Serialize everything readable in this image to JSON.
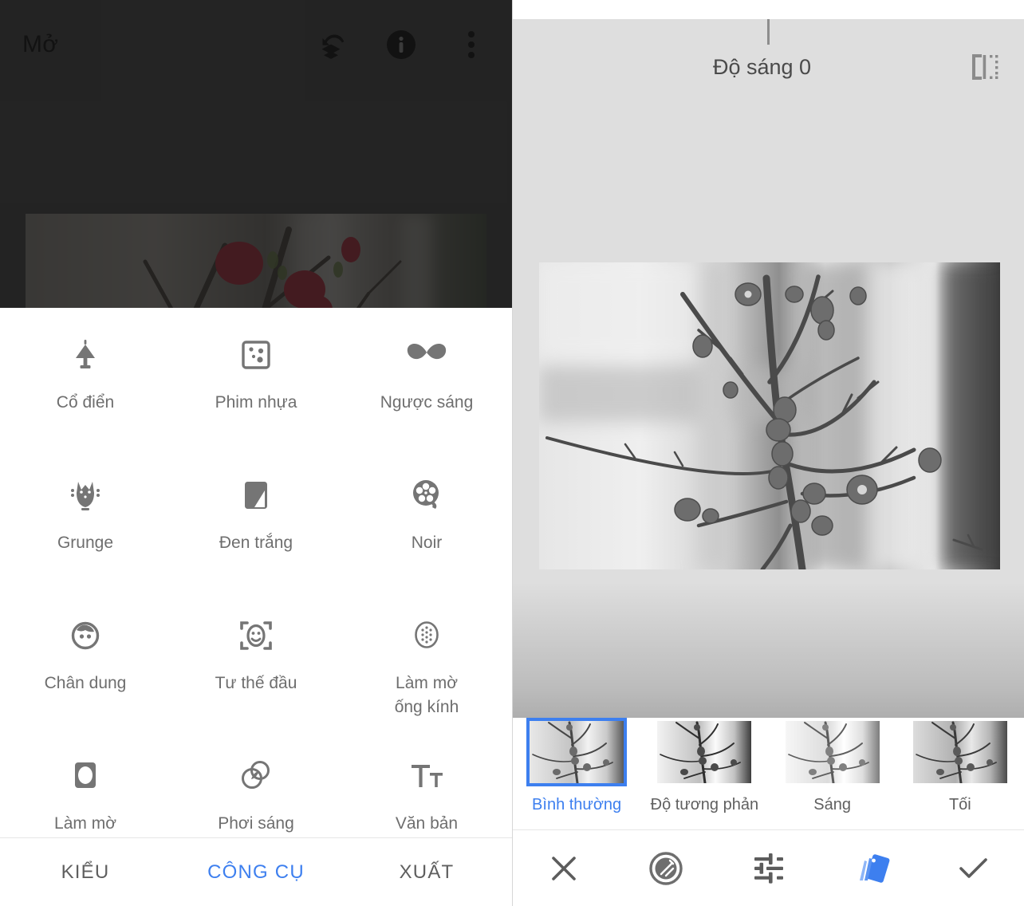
{
  "left": {
    "topbar": {
      "title": "Mở",
      "icons": [
        {
          "name": "revert-icon",
          "label": "Hoàn tác"
        },
        {
          "name": "info-icon",
          "label": "Thông tin"
        },
        {
          "name": "more-vert-icon",
          "label": "Thêm"
        }
      ]
    },
    "tools": [
      {
        "label": "Cổ điển",
        "icon": "lamp-icon"
      },
      {
        "label": "Phim nhựa",
        "icon": "grainy-film-icon"
      },
      {
        "label": "Ngược sáng",
        "icon": "mustache-icon"
      },
      {
        "label": "Grunge",
        "icon": "grunge-icon"
      },
      {
        "label": "Đen trắng",
        "icon": "black-white-icon"
      },
      {
        "label": "Noir",
        "icon": "film-reel-icon"
      },
      {
        "label": "Chân dung",
        "icon": "portrait-icon"
      },
      {
        "label": "Tư thế đầu",
        "icon": "head-pose-icon"
      },
      {
        "label": "Làm mờ\nống kính",
        "icon": "lens-blur-icon"
      },
      {
        "label": "Làm mờ",
        "icon": "vignette-icon"
      },
      {
        "label": "Phơi sáng",
        "icon": "double-exposure-icon"
      },
      {
        "label": "Văn bản",
        "icon": "text-icon"
      }
    ],
    "tabs": [
      {
        "label": "KIỂU",
        "active": false
      },
      {
        "label": "CÔNG CỤ",
        "active": true
      },
      {
        "label": "XUẤT",
        "active": false
      }
    ]
  },
  "right": {
    "header": {
      "title": "Độ sáng 0",
      "compare_icon": "compare-split-icon"
    },
    "filters": [
      {
        "label": "Bình thường",
        "selected": true
      },
      {
        "label": "Độ tương phản",
        "selected": false
      },
      {
        "label": "Sáng",
        "selected": false
      },
      {
        "label": "Tối",
        "selected": false
      }
    ],
    "toolbar": [
      {
        "name": "close-icon",
        "label": "Đóng"
      },
      {
        "name": "looks-icon",
        "label": "Bộ lọc"
      },
      {
        "name": "tune-icon",
        "label": "Điều chỉnh"
      },
      {
        "name": "styles-icon",
        "label": "Kiểu",
        "active": true
      },
      {
        "name": "check-icon",
        "label": "Áp dụng"
      }
    ]
  },
  "colors": {
    "accent": "#3d7fef",
    "dark_bar": "#3a3a3a",
    "stage_bg": "#dedede",
    "icon_gray": "#757575",
    "label_gray": "#6e6e6e"
  }
}
